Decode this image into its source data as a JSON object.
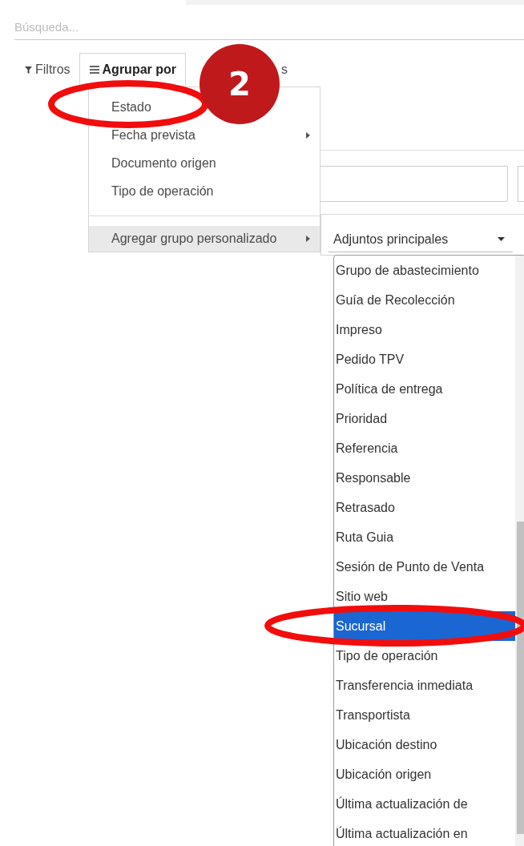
{
  "search": {
    "placeholder": "Búsqueda..."
  },
  "toolbar": [
    {
      "label": "Filtros",
      "kind": "filter",
      "selected": false
    },
    {
      "label": "Agrupar por",
      "kind": "group",
      "selected": true
    },
    {
      "label": "s",
      "kind": "plain",
      "selected": false
    }
  ],
  "group_menu": {
    "items": [
      {
        "label": "Estado",
        "submenu": false,
        "selected": false
      },
      {
        "label": "Fecha prevista",
        "submenu": true,
        "selected": false
      },
      {
        "label": "Documento origen",
        "submenu": false,
        "selected": false
      },
      {
        "label": "Tipo de operación",
        "submenu": false,
        "selected": false
      }
    ],
    "custom": {
      "label": "Agregar grupo personalizado",
      "submenu": true,
      "selected": true
    }
  },
  "custom_group": {
    "value": "Adjuntos principales",
    "options": [
      {
        "label": "Grupo de abastecimiento",
        "selected": false
      },
      {
        "label": "Guía de Recolección",
        "selected": false
      },
      {
        "label": "Impreso",
        "selected": false
      },
      {
        "label": "Pedido TPV",
        "selected": false
      },
      {
        "label": "Política de entrega",
        "selected": false
      },
      {
        "label": "Prioridad",
        "selected": false
      },
      {
        "label": "Referencia",
        "selected": false
      },
      {
        "label": "Responsable",
        "selected": false
      },
      {
        "label": "Retrasado",
        "selected": false
      },
      {
        "label": "Ruta Guia",
        "selected": false
      },
      {
        "label": "Sesión de Punto de Venta",
        "selected": false
      },
      {
        "label": "Sitio web",
        "selected": false
      },
      {
        "label": "Sucursal",
        "selected": true
      },
      {
        "label": "Tipo de operación",
        "selected": false
      },
      {
        "label": "Transferencia inmediata",
        "selected": false
      },
      {
        "label": "Transportista",
        "selected": false
      },
      {
        "label": "Ubicación destino",
        "selected": false
      },
      {
        "label": "Ubicación origen",
        "selected": false
      },
      {
        "label": "Última actualización de",
        "selected": false
      },
      {
        "label": "Última actualización en",
        "selected": false
      }
    ]
  },
  "annotation": {
    "badge": "2"
  }
}
